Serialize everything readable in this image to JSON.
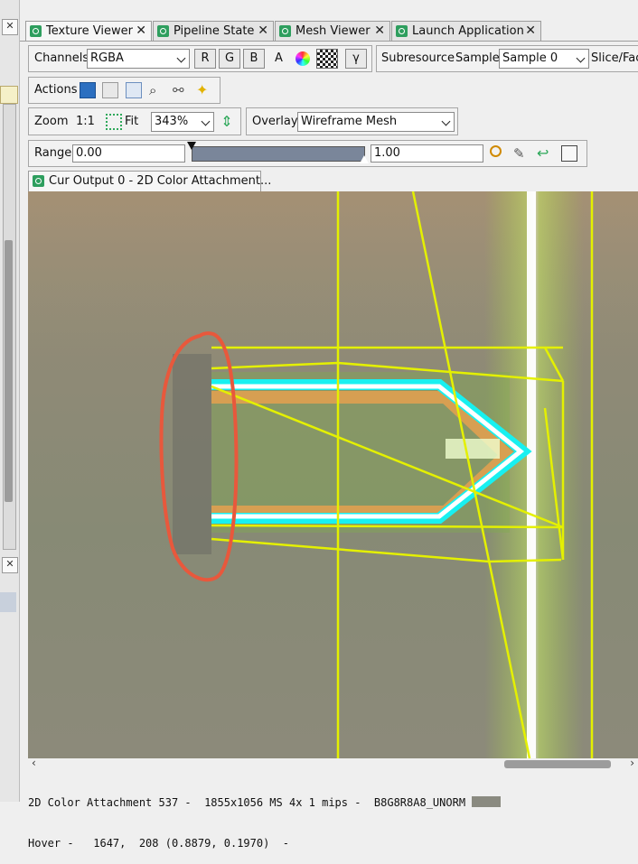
{
  "tabs": [
    {
      "label": "Texture Viewer",
      "active": true
    },
    {
      "label": "Pipeline State",
      "active": false
    },
    {
      "label": "Mesh Viewer",
      "active": false
    },
    {
      "label": "Launch Application",
      "active": false
    }
  ],
  "channels": {
    "label": "Channels",
    "value": "RGBA",
    "r": "R",
    "g": "G",
    "b": "B",
    "a": "A",
    "gamma": "γ",
    "subresource": "Subresource",
    "sample_label": "Sample",
    "sample_value": "Sample 0",
    "slice_label": "Slice/Face"
  },
  "actions": {
    "label": "Actions"
  },
  "zoom": {
    "label": "Zoom",
    "one_to_one": "1:1",
    "fit": "Fit",
    "value": "343%",
    "overlay_label": "Overlay",
    "overlay_value": "Wireframe Mesh"
  },
  "range": {
    "label": "Range",
    "min": "0.00",
    "max": "1.00"
  },
  "output_tab": {
    "label": "Cur Output 0 - 2D Color Attachment..."
  },
  "status": {
    "line1": "2D Color Attachment 537 -  1855x1056 MS 4x 1 mips -  B8G8R8A8_UNORM",
    "line2": "Hover -   1647,  208 (0.8879, 0.1970)  -"
  },
  "colors": {
    "wire": "#e4f000",
    "cyan": "#18f0f0",
    "annotation": "#e8583c"
  }
}
